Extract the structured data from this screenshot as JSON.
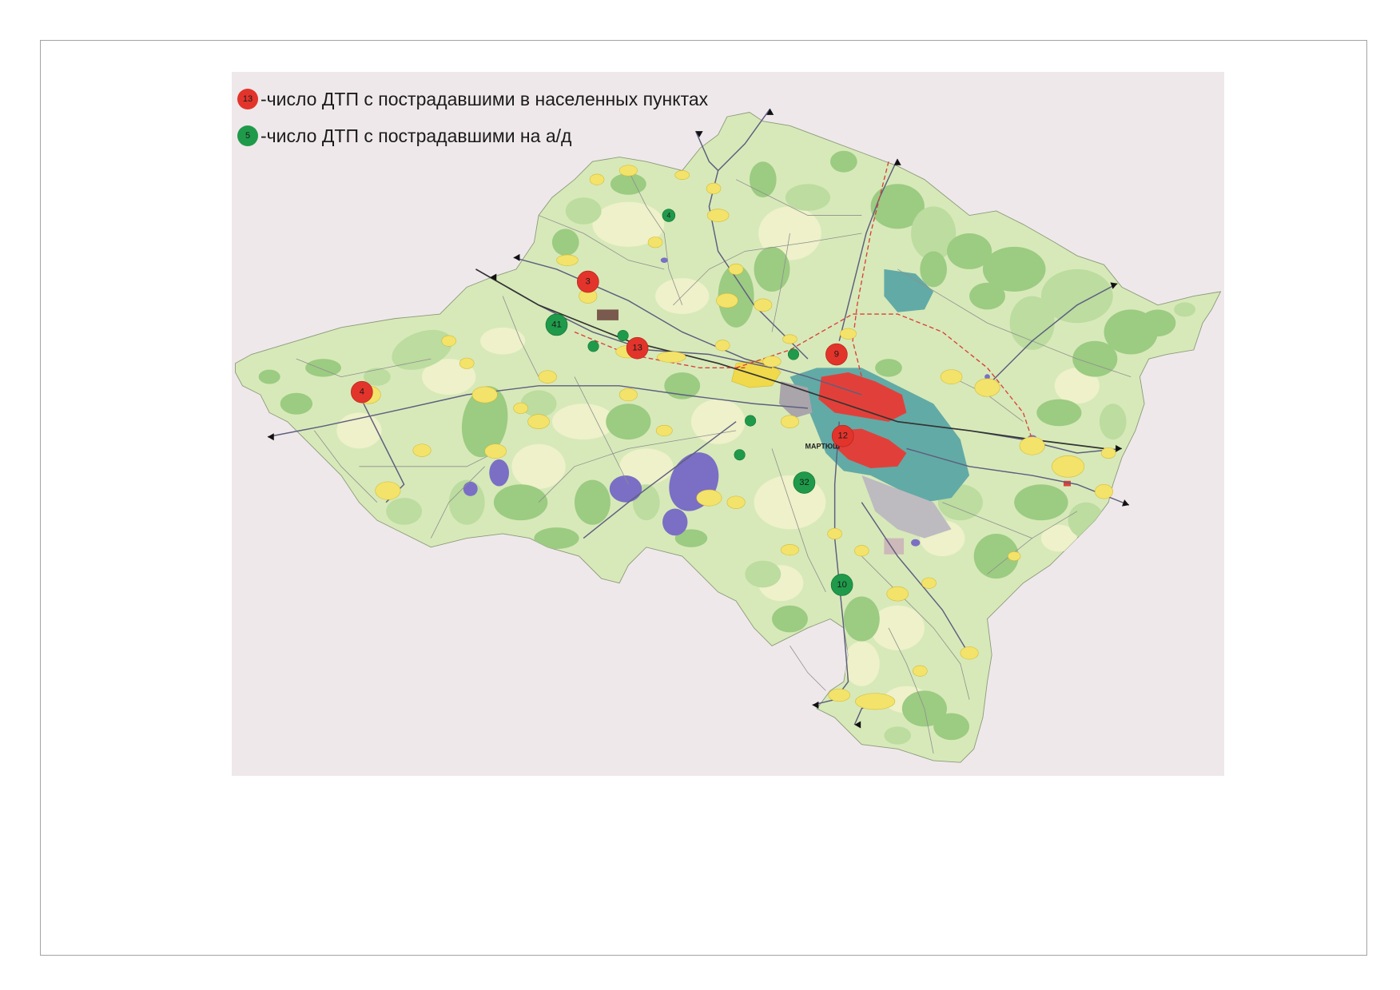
{
  "legend": {
    "settlements": {
      "badge": "13",
      "label": "-число ДТП с пострадавшими в населенных пунктах",
      "color": "#e2342b"
    },
    "roads": {
      "badge": "5",
      "label": "-число ДТП с пострадавшими на а/д",
      "color": "#1f9a4a"
    }
  },
  "settlement_accidents": [
    "3",
    "13",
    "4",
    "9",
    "12"
  ],
  "road_accidents": [
    "4",
    "41",
    "32",
    "10"
  ],
  "place_labels": {
    "martyush": "МАРТЮШ"
  },
  "colors": {
    "map_background": "#efe8ea",
    "region_fill": "#d7e9b9",
    "forest": "#9ccb82",
    "lake": "#7a6fc4",
    "city_red": "#e1403a",
    "city_teal": "#62aaa6",
    "settlement": "#f3e36a",
    "railway": "#d9403a"
  }
}
